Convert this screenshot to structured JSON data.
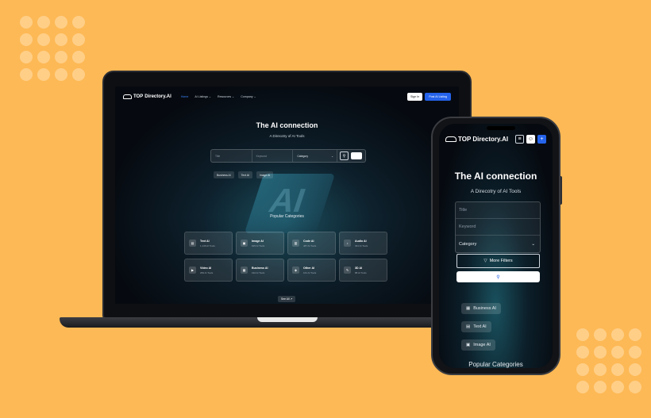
{
  "laptop": {
    "nav": {
      "logo_main": "TOP",
      "logo_sub": "Directory.AI",
      "menu": [
        {
          "label": "Home",
          "active": true
        },
        {
          "label": "AI Listings ⌄",
          "active": false
        },
        {
          "label": "Resources ⌄",
          "active": false
        },
        {
          "label": "Company ⌄",
          "active": false
        }
      ],
      "sign_in": "Sign In",
      "post_listing": "Post AI Listing"
    },
    "hero": {
      "title": "The AI connection",
      "subtitle": "A Direcotry of AI Tools"
    },
    "search": {
      "title_placeholder": "Title",
      "keyword_placeholder": "Keyword",
      "category_label": "Category"
    },
    "chips": [
      "Business AI",
      "Text AI",
      "Image AI"
    ],
    "popular_heading": "Popular Categories",
    "categories": [
      {
        "name": "Text AI",
        "count": "1,146 AI Tools",
        "icon": "text-icon"
      },
      {
        "name": "Image AI",
        "count": "625 AI Tools",
        "icon": "image-icon"
      },
      {
        "name": "Code AI",
        "count": "487 AI Tools",
        "icon": "code-icon"
      },
      {
        "name": "Audio AI",
        "count": "331 AI Tools",
        "icon": "audio-icon"
      },
      {
        "name": "Video AI",
        "count": "269 AI Tools",
        "icon": "video-icon"
      },
      {
        "name": "Business AI",
        "count": "192 AI Tools",
        "icon": "briefcase-icon"
      },
      {
        "name": "Other AI",
        "count": "161 AI Tools",
        "icon": "other-icon"
      },
      {
        "name": "3D AI",
        "count": "88 AI Tools",
        "icon": "pen-icon"
      }
    ],
    "see_all": "See All ↗"
  },
  "phone": {
    "logo_main": "TOP",
    "logo_sub": "Directory.AI",
    "hero_title": "The AI connection",
    "hero_subtitle": "A Direcotry of AI Tools",
    "title_placeholder": "Title",
    "keyword_placeholder": "Keyword",
    "category_label": "Category",
    "more_filters": "More Filters",
    "chips": [
      "Business AI",
      "Text AI",
      "Image AI"
    ],
    "popular_heading": "Popular Categories"
  },
  "colors": {
    "background": "#FDB956",
    "accent": "#2563EB"
  }
}
